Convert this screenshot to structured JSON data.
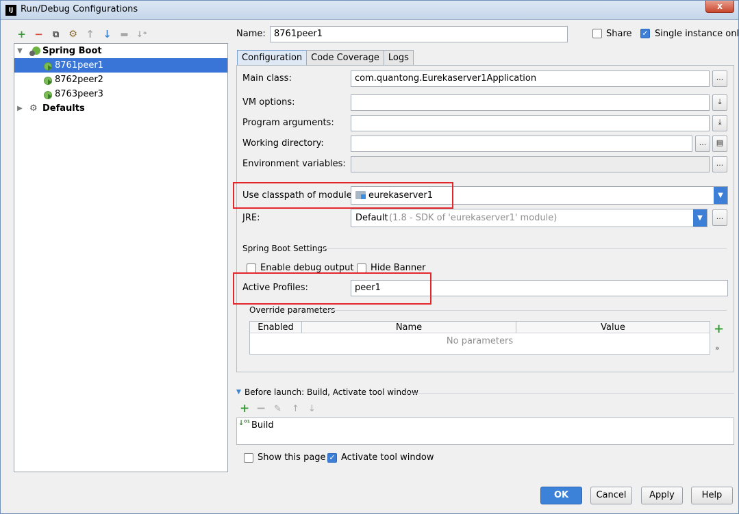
{
  "window": {
    "title": "Run/Debug Configurations",
    "app_icon": "IJ",
    "close": "x"
  },
  "toolbar": {
    "icons": [
      "add-icon",
      "remove-icon",
      "copy-icon",
      "settings-icon",
      "move-up-icon",
      "move-down-icon",
      "folder-icon",
      "sort-icon"
    ]
  },
  "tree": {
    "root_label": "Spring Boot",
    "items": [
      {
        "label": "8761peer1"
      },
      {
        "label": "8762peer2"
      },
      {
        "label": "8763peer3"
      }
    ],
    "defaults_label": "Defaults"
  },
  "header": {
    "name_label": "Name:",
    "name_value": "8761peer1",
    "share_label": "Share",
    "single_instance_label": "Single instance only"
  },
  "tabs": [
    {
      "label": "Configuration"
    },
    {
      "label": "Code Coverage"
    },
    {
      "label": "Logs"
    }
  ],
  "form": {
    "main_class_label": "Main class:",
    "main_class_value": "com.quantong.Eurekaserver1Application",
    "vm_options_label": "VM options:",
    "program_args_label": "Program arguments:",
    "working_dir_label": "Working directory:",
    "env_vars_label": "Environment variables:",
    "classpath_label": "Use classpath of module:",
    "classpath_value": "eurekaserver1",
    "jre_label": "JRE:",
    "jre_value": "Default",
    "jre_detail": "(1.8 - SDK of 'eurekaserver1' module)",
    "ellipsis": "..."
  },
  "spring_boot_settings": {
    "section_title": "Spring Boot Settings",
    "enable_debug_label": "Enable debug output",
    "hide_banner_label": "Hide Banner",
    "active_profiles_label": "Active Profiles:",
    "active_profiles_value": "peer1",
    "override_title": "Override parameters",
    "columns": [
      "Enabled",
      "Name",
      "Value"
    ],
    "empty_text": "No parameters",
    "add_glyph": "+",
    "expand_glyph": "»"
  },
  "before_launch": {
    "title": "Before launch: Build, Activate tool window",
    "items": [
      {
        "label": "Build"
      }
    ],
    "show_page_label": "Show this page",
    "activate_tool_label": "Activate tool window"
  },
  "buttons": {
    "ok": "OK",
    "cancel": "Cancel",
    "apply": "Apply",
    "help": "Help"
  },
  "colors": {
    "selection": "#3875d7",
    "highlight_box": "#e2262b",
    "primary_button": "#3d82d9"
  }
}
